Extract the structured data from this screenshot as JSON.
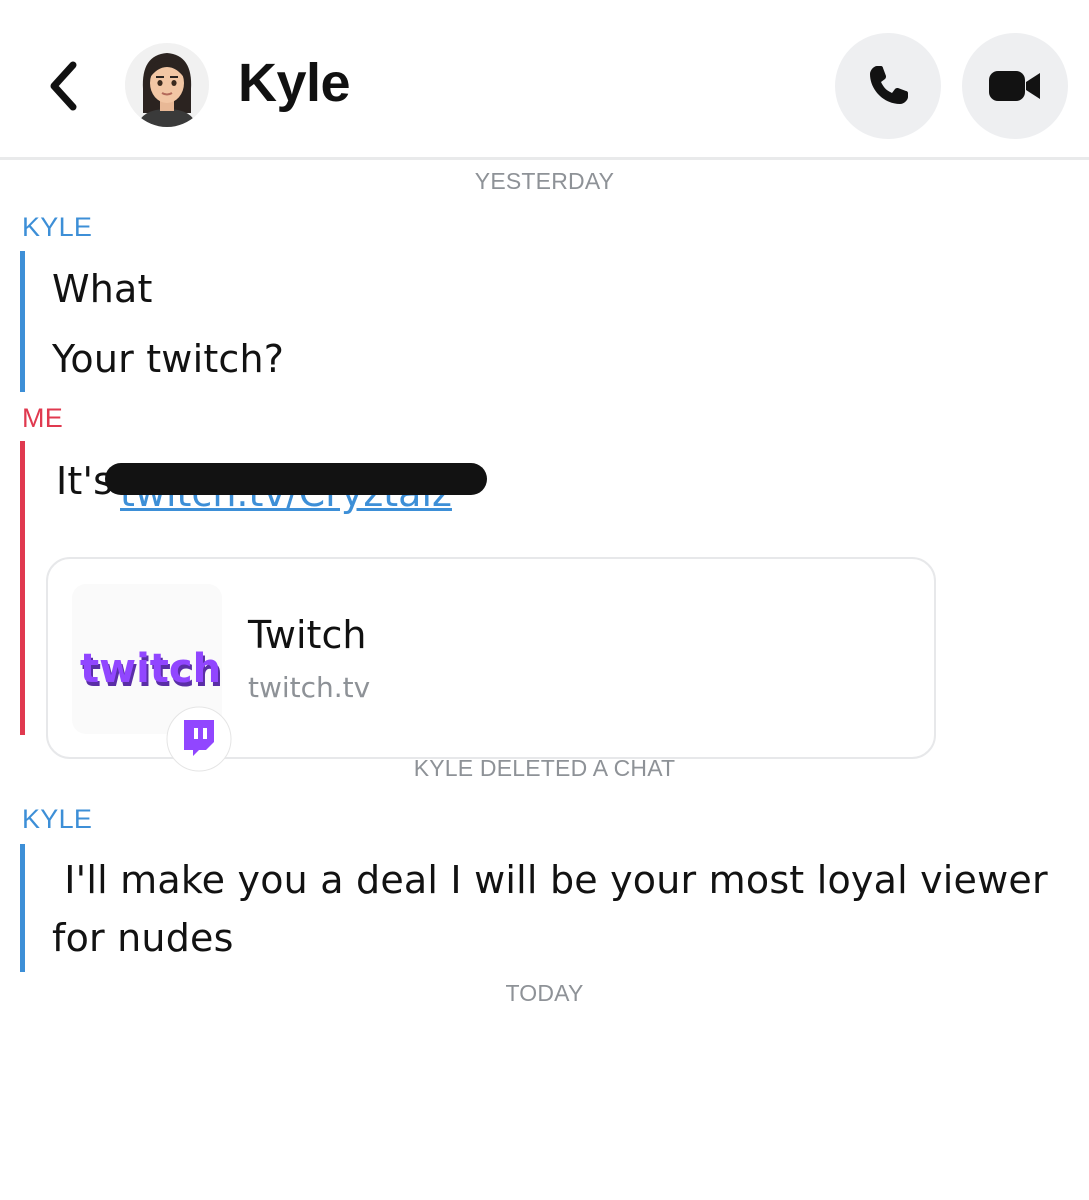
{
  "header": {
    "contact_name": "Kyle",
    "icons": {
      "back": "chevron-left-icon",
      "call": "phone-icon",
      "video": "video-camera-icon"
    }
  },
  "chat": {
    "separator_yesterday": "YESTERDAY",
    "block1": {
      "sender": "KYLE",
      "messages": [
        "What",
        "Your twitch?"
      ]
    },
    "block2": {
      "sender": "ME",
      "message_prefix": "It's",
      "link_text": "twitch.tv/Cryztaiz",
      "link_card": {
        "title": "Twitch",
        "domain": "twitch.tv",
        "logo_text": "twitch"
      }
    },
    "deleted_notice": "KYLE DELETED A CHAT",
    "block3": {
      "sender": "KYLE",
      "message_line1": " I'll make you a deal I will be your most loyal viewer",
      "message_line2": "for nudes"
    },
    "separator_today": "TODAY"
  },
  "colors": {
    "kyle": "#3d8fd7",
    "me": "#e0394f",
    "twitch_purple": "#9146ff",
    "muted": "#8e9297"
  }
}
